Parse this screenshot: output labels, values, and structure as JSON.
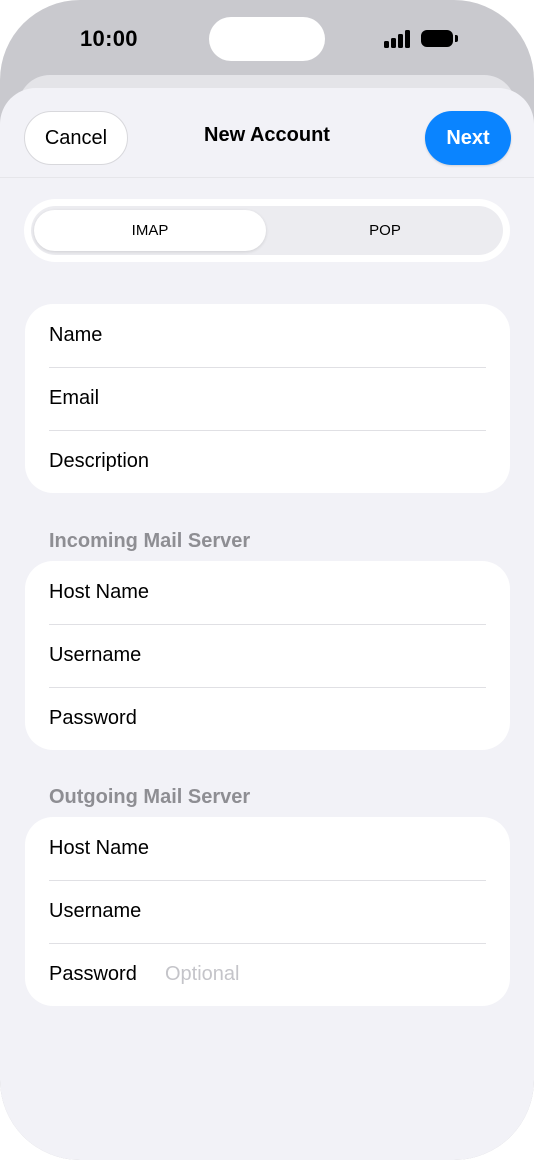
{
  "status_bar": {
    "time": "10:00"
  },
  "nav": {
    "cancel_label": "Cancel",
    "title": "New Account",
    "next_label": "Next"
  },
  "account_type": {
    "options": [
      "IMAP",
      "POP"
    ],
    "selected": "IMAP"
  },
  "account_info": {
    "fields": [
      {
        "label": "Name",
        "value": ""
      },
      {
        "label": "Email",
        "value": ""
      },
      {
        "label": "Description",
        "value": ""
      }
    ]
  },
  "incoming": {
    "header": "Incoming Mail Server",
    "fields": [
      {
        "label": "Host Name",
        "value": ""
      },
      {
        "label": "Username",
        "value": ""
      },
      {
        "label": "Password",
        "value": ""
      }
    ]
  },
  "outgoing": {
    "header": "Outgoing Mail Server",
    "fields": [
      {
        "label": "Host Name",
        "value": ""
      },
      {
        "label": "Username",
        "value": ""
      },
      {
        "label": "Password",
        "value": "",
        "placeholder": "Optional"
      }
    ]
  },
  "colors": {
    "accent": "#0a84ff",
    "background": "#f2f2f7",
    "section_header": "#8e8e93",
    "placeholder": "#c4c4c9"
  }
}
